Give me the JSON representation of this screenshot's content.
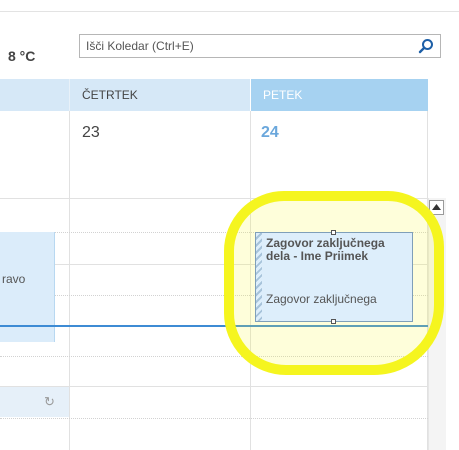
{
  "weather": {
    "temp": "8 °C"
  },
  "search": {
    "placeholder": "Išči Koledar (Ctrl+E)",
    "icon": "search-icon"
  },
  "calendar": {
    "days": [
      {
        "name": "ČETRTEK",
        "date": "23"
      },
      {
        "name": "PETEK",
        "date": "24"
      }
    ],
    "left_event": {
      "text": "ravo",
      "icon": "recurrence-icon"
    }
  },
  "appointment": {
    "subject": "Zagovor zaključnega dela - Ime Priimek",
    "location": "Zagovor zaključnega"
  },
  "colors": {
    "today_header": "#a6d2f1",
    "header": "#d6e8f7",
    "now_line": "#3d8bd4",
    "highlight": "#f5f51f"
  }
}
